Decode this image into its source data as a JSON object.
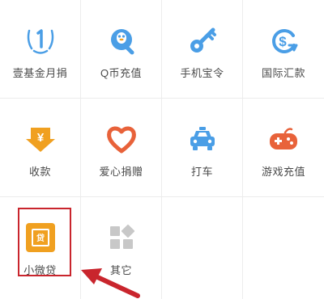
{
  "services": [
    {
      "label": "壹基金月捐",
      "icon": "one-foundation-icon"
    },
    {
      "label": "Q币充值",
      "icon": "qq-penguin-icon"
    },
    {
      "label": "手机宝令",
      "icon": "key-icon"
    },
    {
      "label": "国际汇款",
      "icon": "dollar-transfer-icon"
    },
    {
      "label": "收款",
      "icon": "yuan-download-icon"
    },
    {
      "label": "爱心捐赠",
      "icon": "heart-icon"
    },
    {
      "label": "打车",
      "icon": "taxi-icon"
    },
    {
      "label": "游戏充值",
      "icon": "gamepad-icon"
    },
    {
      "label": "小微贷",
      "icon": "micro-loan-icon"
    },
    {
      "label": "其它",
      "icon": "more-grid-icon"
    }
  ],
  "colors": {
    "blue": "#4a9ee6",
    "orange": "#f0a020",
    "red": "#e8623a",
    "highlight": "#c9252d",
    "gray": "#c8c8c8"
  }
}
